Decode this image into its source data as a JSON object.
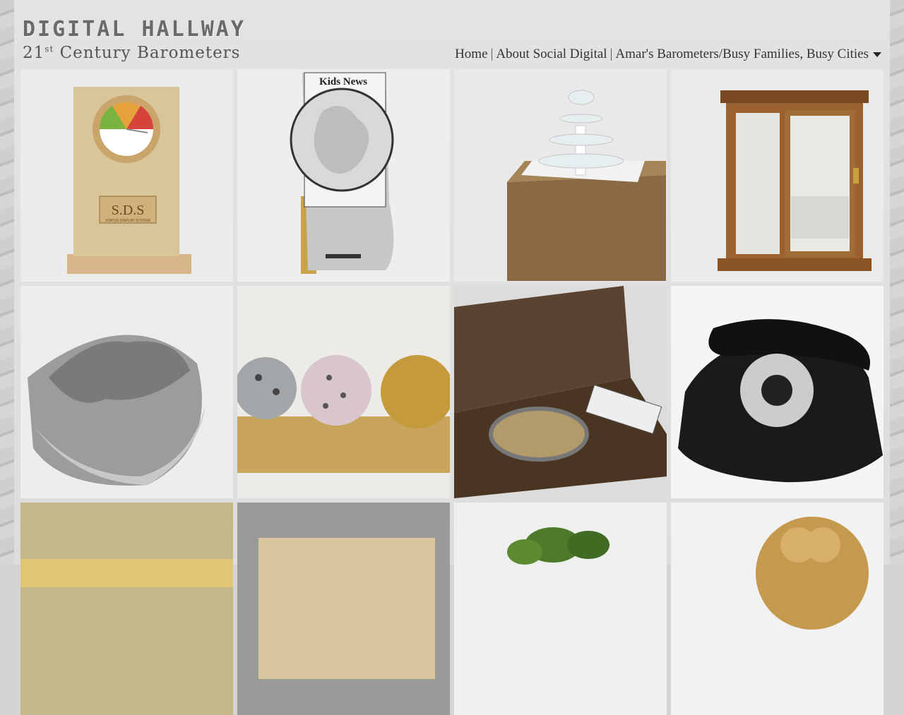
{
  "site": {
    "logo": "DIGITAL HALLWAY",
    "subtitle_prefix": "21",
    "subtitle_sup": "st",
    "subtitle_rest": " Century Barometers"
  },
  "nav": {
    "items": [
      "Home",
      "About Social Digital",
      "Amar's Barometers/Busy Families, Busy Cities"
    ],
    "separator": "|"
  },
  "gallery": {
    "tiles": [
      {
        "name": "status-display-system",
        "icon": "dial-icon",
        "label": "S.D.S",
        "sublabel": "STATUS DISPLAY SYSTEM"
      },
      {
        "name": "kids-news",
        "icon": "newspaper-icon",
        "label": "Kids News"
      },
      {
        "name": "glass-fountain",
        "icon": "fountain-icon"
      },
      {
        "name": "wooden-display-case",
        "icon": "cabinet-icon"
      },
      {
        "name": "metal-bowl",
        "icon": "bowl-icon"
      },
      {
        "name": "three-spheres",
        "icon": "spheres-icon"
      },
      {
        "name": "music-box",
        "icon": "box-icon"
      },
      {
        "name": "rotary-telephone",
        "icon": "telephone-icon"
      },
      {
        "name": "wooden-block",
        "icon": "block-icon"
      },
      {
        "name": "ornate-box",
        "icon": "box-icon"
      },
      {
        "name": "potted-plant",
        "icon": "plant-icon"
      },
      {
        "name": "clover-object",
        "icon": "clover-icon"
      }
    ]
  },
  "colors": {
    "background": "#d4d4d4",
    "page": "#e0e0e0",
    "text": "#333333"
  }
}
